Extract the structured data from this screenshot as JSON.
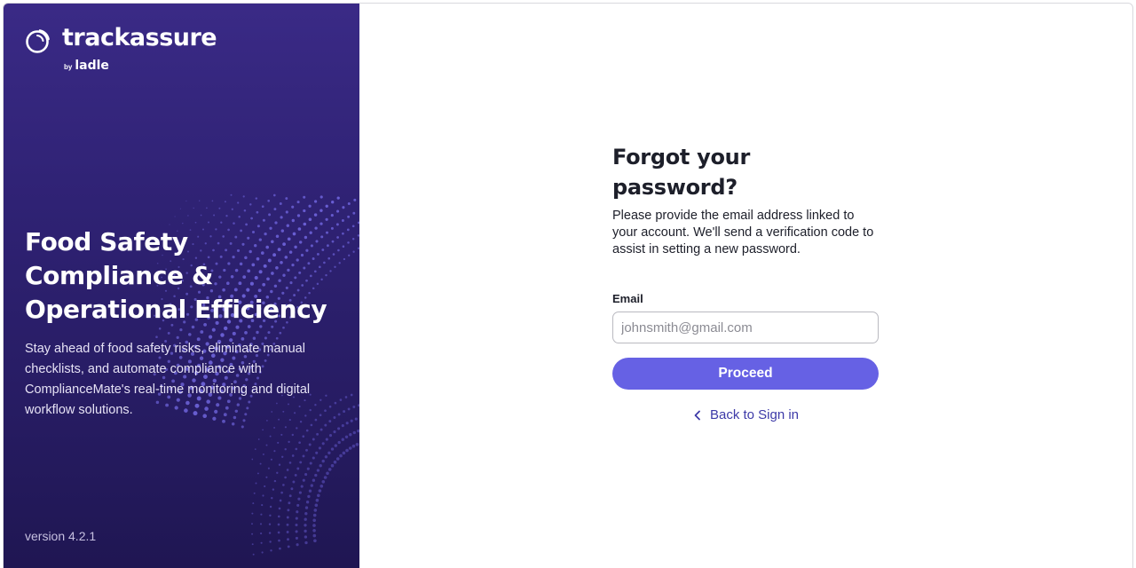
{
  "brand": {
    "name": "trackassure",
    "by": "by",
    "parent": "ladle",
    "logo_icon": "trackassure-logo-icon",
    "primary_color": "#3a2a86",
    "accent_color": "#6661e4"
  },
  "hero": {
    "title_lines": [
      "Food Safety",
      "Compliance &",
      "Operational Efficiency"
    ],
    "description": "Stay ahead of food safety risks, eliminate manual checklists, and automate compliance with ComplianceMate's real-time monitoring and digital workflow solutions."
  },
  "version": "version 4.2.1",
  "form": {
    "title_lines": [
      "Forgot your",
      "password?"
    ],
    "description": "Please provide the email address linked to your account. We'll send a verification code to assist in setting a new password.",
    "email_label": "Email",
    "email_placeholder": "johnsmith@gmail.com",
    "email_value": "",
    "proceed_label": "Proceed",
    "back_label": "Back to Sign in",
    "back_icon": "chevron-left-icon"
  }
}
